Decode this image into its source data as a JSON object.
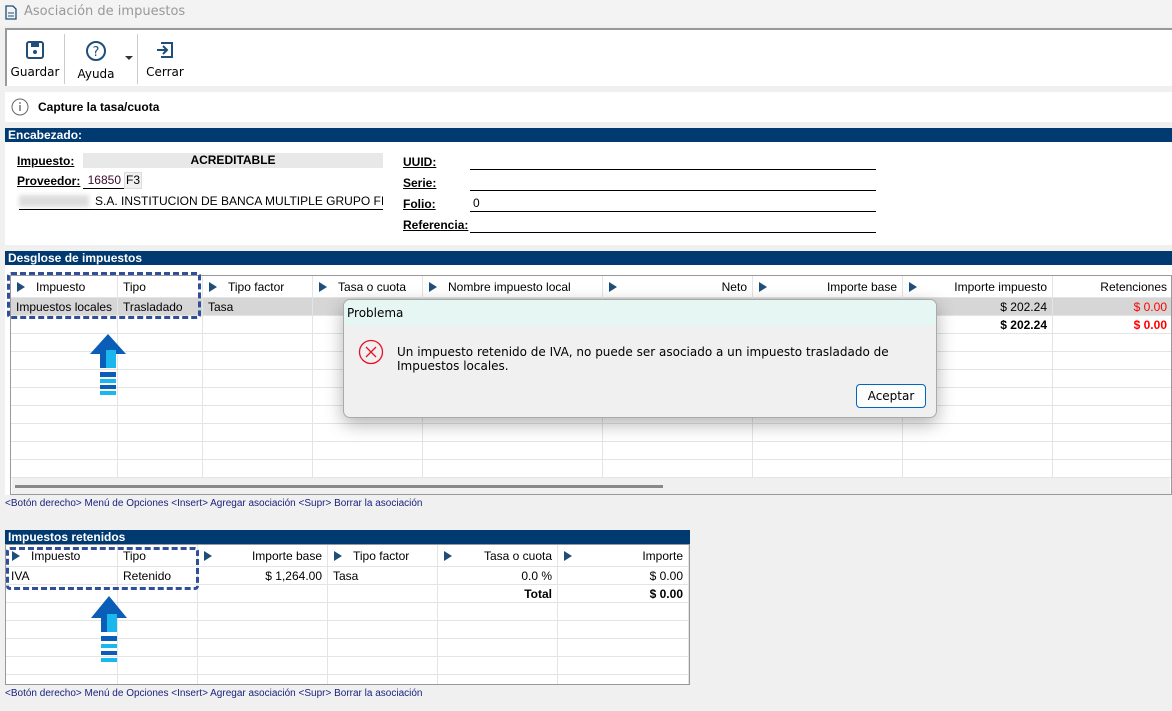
{
  "window": {
    "title": "Asociación de impuestos",
    "icon": "document-icon"
  },
  "toolbar": {
    "save": "Guardar",
    "help": "Ayuda",
    "close": "Cerrar"
  },
  "info": {
    "message": "Capture la tasa/cuota",
    "icon": "info-icon"
  },
  "header": {
    "section": "Encabezado:",
    "impuesto_label": "Impuesto:",
    "impuesto_value": "ACREDITABLE",
    "proveedor_label": "Proveedor:",
    "proveedor_value": "16850",
    "proveedor_key": "F3",
    "proveedor_name": "S.A. INSTITUCION DE BANCA MULTIPLE GRUPO FINANCIERO",
    "uuid_label": "UUID:",
    "uuid_value": "",
    "serie_label": "Serie:",
    "serie_value": "",
    "folio_label": "Folio:",
    "folio_value": "0",
    "referencia_label": "Referencia:",
    "referencia_value": ""
  },
  "desglose": {
    "section": "Desglose de impuestos",
    "columns": [
      "Impuesto",
      "Tipo",
      "Tipo factor",
      "Tasa o cuota",
      "Nombre impuesto local",
      "Neto",
      "Importe base",
      "Importe impuesto",
      "Retenciones"
    ],
    "rows": [
      [
        "Impuestos locales",
        "Trasladado",
        "Tasa",
        "",
        "",
        "",
        "",
        "$ 202.24",
        "$ 0.00"
      ]
    ],
    "totals": {
      "importe_impuesto": "$ 202.24",
      "retenciones": "$ 0.00"
    },
    "hint": "<Botón derecho> Menú de Opciones  <Insert> Agregar asociación  <Supr> Borrar la asociación"
  },
  "retenidos": {
    "section": "Impuestos retenidos",
    "columns": [
      "Impuesto",
      "Tipo",
      "Importe base",
      "Tipo factor",
      "Tasa o cuota",
      "Importe"
    ],
    "rows": [
      [
        "IVA",
        "Retenido",
        "$ 1,264.00",
        "Tasa",
        "0.0 %",
        "$ 0.00"
      ]
    ],
    "total_label": "Total",
    "total_value": "$ 0.00",
    "hint": "<Botón derecho> Menú de Opciones  <Insert> Agregar asociación  <Supr> Borrar la asociación"
  },
  "dialog": {
    "title": "Problema",
    "message": "Un impuesto retenido de IVA, no puede ser asociado a un impuesto trasladado de Impuestos locales.",
    "button": "Aceptar",
    "icon": "error-icon"
  },
  "colors": {
    "section_bar": "#003a70",
    "error": "#e81123",
    "negative": "#ff0000",
    "highlight": "#2f4f9a"
  }
}
